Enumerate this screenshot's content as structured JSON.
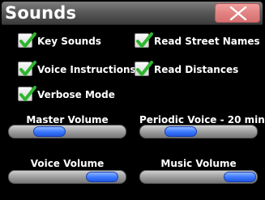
{
  "window": {
    "title": "Sounds",
    "close_icon": "close-icon"
  },
  "options": {
    "key_sounds": {
      "label": "Key Sounds",
      "checked": true
    },
    "read_street_names": {
      "label": "Read Street Names",
      "checked": true
    },
    "voice_instructions": {
      "label": "Voice Instructions",
      "checked": true
    },
    "read_distances": {
      "label": "Read Distances",
      "checked": true
    },
    "verbose_mode": {
      "label": "Verbose Mode",
      "checked": true
    }
  },
  "sliders": {
    "master_volume": {
      "label": "Master Volume",
      "level": 0.35
    },
    "periodic_voice": {
      "label": "Periodic Voice - 20 min",
      "level": 0.35
    },
    "voice_volume": {
      "label": "Voice Volume",
      "level": 0.8
    },
    "music_volume": {
      "label": "Music Volume",
      "level": 0.9
    }
  },
  "colors": {
    "background": "#000000",
    "close_button": "#e48585",
    "checkmark": "#2fb52f",
    "slider_thumb": "#3f7bff"
  }
}
